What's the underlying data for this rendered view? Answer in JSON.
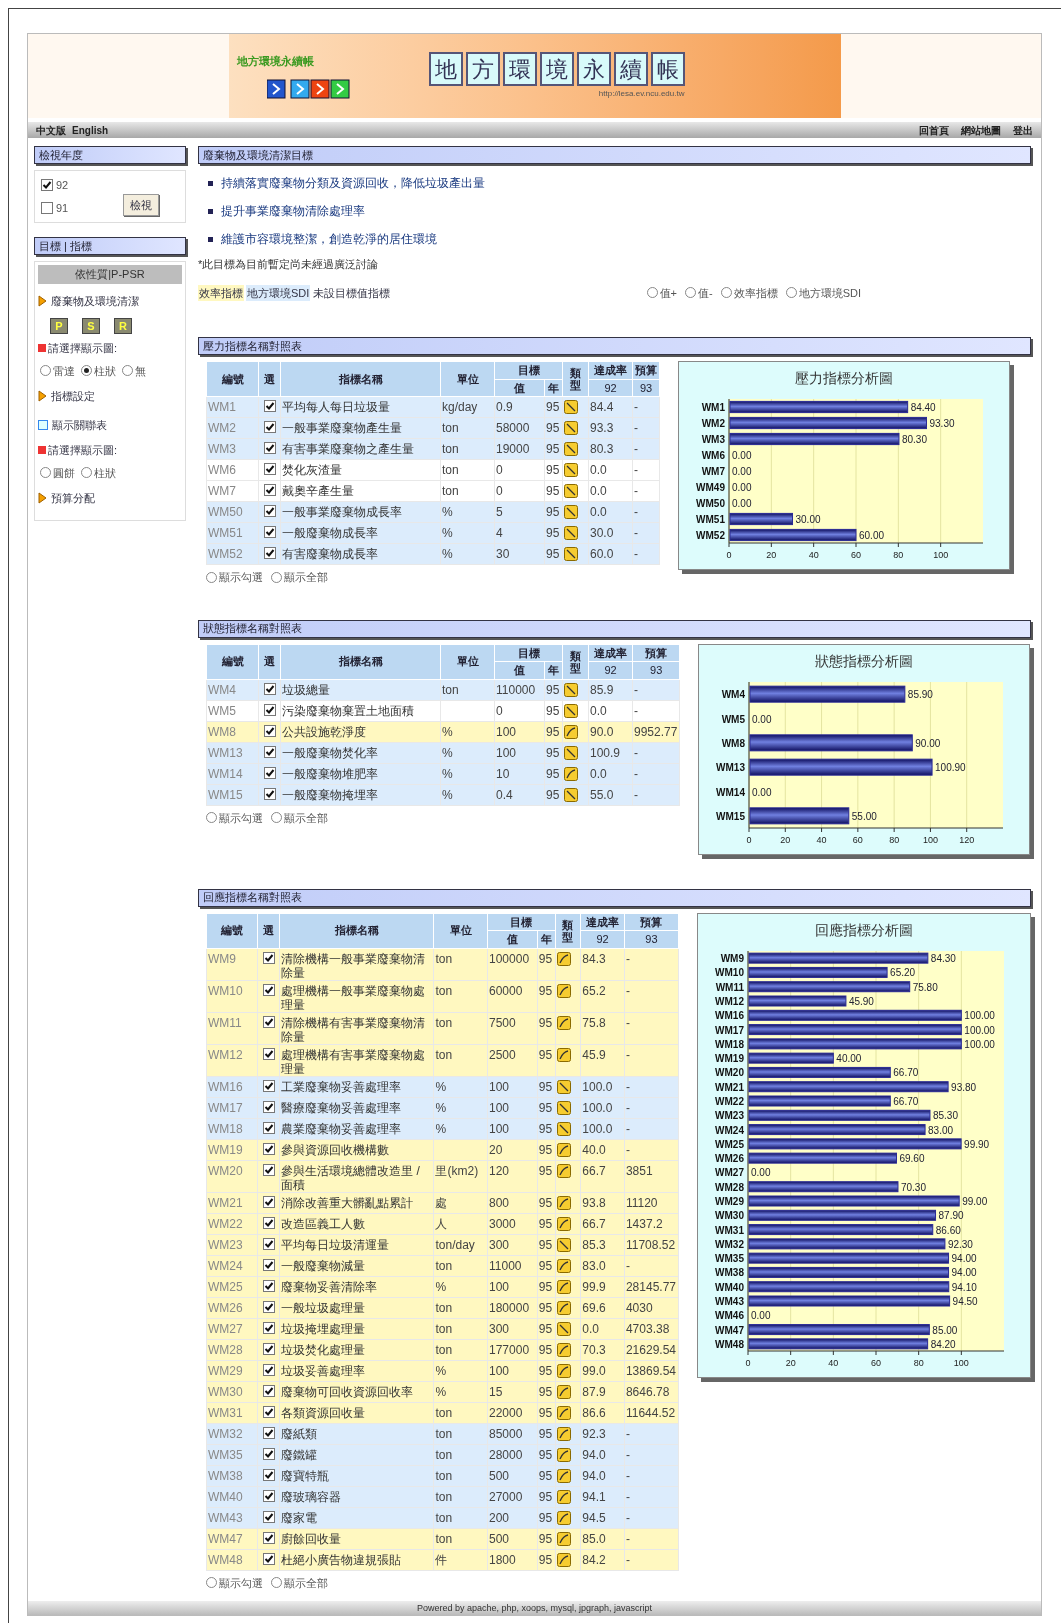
{
  "header": {
    "logo_text": "地方環境永續帳",
    "tiles": [
      "地",
      "方",
      "環",
      "境",
      "永",
      "續",
      "帳"
    ],
    "url": "http://lesa.ev.ncu.edu.tw"
  },
  "nav": {
    "left": [
      "中文版",
      "English"
    ],
    "right": [
      "回首頁",
      "網站地圖",
      "登出"
    ]
  },
  "year_panel": {
    "title": "檢視年度",
    "years": [
      {
        "label": "92",
        "checked": true
      },
      {
        "label": "91",
        "checked": false
      }
    ],
    "button": "檢視"
  },
  "goal_panel": {
    "title": "目標 | 指標",
    "subtitle": "依性質|P-PSR",
    "items": [
      {
        "kind": "arrow",
        "label": "廢棄物及環境清潔"
      },
      {
        "kind": "buttons",
        "labels": [
          "P",
          "S",
          "R"
        ]
      },
      {
        "kind": "prompt",
        "label": "請選擇顯示圖:"
      },
      {
        "kind": "radios",
        "options": [
          {
            "label": "雷達",
            "selected": false
          },
          {
            "label": "柱狀",
            "selected": true
          },
          {
            "label": "無",
            "selected": false
          }
        ]
      },
      {
        "kind": "arrow",
        "label": "指標設定"
      },
      {
        "kind": "table-link",
        "label": "顯示關聯表"
      },
      {
        "kind": "prompt",
        "label": "請選擇顯示圖:"
      },
      {
        "kind": "radios",
        "options": [
          {
            "label": "圓餅",
            "selected": false
          },
          {
            "label": "柱狀",
            "selected": false
          }
        ]
      },
      {
        "kind": "arrow",
        "label": "預算分配"
      }
    ]
  },
  "goals": {
    "title": "廢棄物及環境清潔目標",
    "items": [
      "持續落實廢棄物分類及資源回收，降低垃圾產出量",
      "提升事業廢棄物清除處理率",
      "維護市容環境整潔，創造乾淨的居住環境"
    ],
    "note": "*此目標為目前暫定尚未經過廣泛討論",
    "legend": [
      {
        "label": "效率指標",
        "color": "#fff8c0"
      },
      {
        "label": "地方環境SDI",
        "color": "#dcecfc"
      },
      {
        "label": "未設目標值指標"
      }
    ],
    "filters": [
      {
        "label": "值+",
        "selected": false
      },
      {
        "label": "值-",
        "selected": false
      },
      {
        "label": "效率指標",
        "selected": false
      },
      {
        "label": "地方環境SDI",
        "selected": false
      }
    ]
  },
  "sections": [
    {
      "title": "壓力指標名稱對照表",
      "headers": {
        "id": "編號",
        "select": "選",
        "name": "指標名稱",
        "unit": "單位",
        "target": "目標",
        "value": "值",
        "year": "年",
        "type": "類型",
        "rate": "達成率",
        "budget": "預算",
        "rate_year": "92",
        "budget_year": "93"
      },
      "rows": [
        {
          "id": "WM1",
          "checked": true,
          "name": "平均每人每日垃圾量",
          "unit": "kg/day",
          "target": "0.9",
          "year": "95",
          "kind": "down",
          "rate": "84.4",
          "budget": "-",
          "color": "#dcecfc"
        },
        {
          "id": "WM2",
          "checked": true,
          "name": "一般事業廢棄物產生量",
          "unit": "ton",
          "target": "58000",
          "year": "95",
          "kind": "down",
          "rate": "93.3",
          "budget": "-",
          "color": "#dcecfc"
        },
        {
          "id": "WM3",
          "checked": true,
          "name": "有害事業廢棄物之產生量",
          "unit": "ton",
          "target": "19000",
          "year": "95",
          "kind": "down",
          "rate": "80.3",
          "budget": "-",
          "color": "#dcecfc"
        },
        {
          "id": "WM6",
          "checked": true,
          "name": "焚化灰渣量",
          "unit": "ton",
          "target": "0",
          "year": "95",
          "kind": "down",
          "rate": "0.0",
          "budget": "-",
          "color": "#ffffff"
        },
        {
          "id": "WM7",
          "checked": true,
          "name": "戴奧辛產生量",
          "unit": "ton",
          "target": "0",
          "year": "95",
          "kind": "down",
          "rate": "0.0",
          "budget": "-",
          "color": "#ffffff"
        },
        {
          "id": "WM50",
          "checked": true,
          "name": "一般事業廢棄物成長率",
          "unit": "%",
          "target": "5",
          "year": "95",
          "kind": "down",
          "rate": "0.0",
          "budget": "-",
          "color": "#dcecfc"
        },
        {
          "id": "WM51",
          "checked": true,
          "name": "一般廢棄物成長率",
          "unit": "%",
          "target": "4",
          "year": "95",
          "kind": "down",
          "rate": "30.0",
          "budget": "-",
          "color": "#dcecfc"
        },
        {
          "id": "WM52",
          "checked": true,
          "name": "有害廢棄物成長率",
          "unit": "%",
          "target": "30",
          "year": "95",
          "kind": "down",
          "rate": "60.0",
          "budget": "-",
          "color": "#dcecfc"
        }
      ],
      "show": [
        {
          "label": "顯示勾選",
          "selected": false
        },
        {
          "label": "顯示全部",
          "selected": false
        }
      ],
      "chart_data": {
        "type": "bar",
        "orientation": "horizontal",
        "title": "壓力指標分析圖",
        "categories": [
          "WM1",
          "WM2",
          "WM3",
          "WM6",
          "WM7",
          "WM49",
          "WM50",
          "WM51",
          "WM52"
        ],
        "series": [
          {
            "color": "#2a2a96",
            "values": [
              84.4,
              93.3,
              80.3,
              0,
              0,
              0,
              0,
              30,
              60
            ]
          }
        ],
        "grid": true,
        "xlim": [
          0,
          120
        ],
        "xticks": [
          0,
          20,
          40,
          60,
          80,
          100
        ],
        "value_labels": [
          "84.40",
          "93.30",
          "80.30",
          "0.00",
          "0.00",
          "0.00",
          "0.00",
          "30.00",
          "60.00"
        ]
      }
    },
    {
      "title": "狀態指標名稱對照表",
      "headers": {
        "id": "編號",
        "select": "選",
        "name": "指標名稱",
        "unit": "單位",
        "target": "目標",
        "value": "值",
        "year": "年",
        "type": "類型",
        "rate": "達成率",
        "budget": "預算",
        "rate_year": "92",
        "budget_year": "93"
      },
      "rows": [
        {
          "id": "WM4",
          "checked": true,
          "name": "垃圾總量",
          "unit": "ton",
          "target": "110000",
          "year": "95",
          "kind": "down",
          "rate": "85.9",
          "budget": "-",
          "color": "#dcecfc"
        },
        {
          "id": "WM5",
          "checked": true,
          "name": "污染廢棄物棄置土地面積",
          "target": "0",
          "year": "95",
          "kind": "down",
          "rate": "0.0",
          "budget": "-",
          "color": "#ffffff"
        },
        {
          "id": "WM8",
          "checked": true,
          "name": "公共設施乾淨度",
          "unit": "%",
          "target": "100",
          "year": "95",
          "kind": "up",
          "rate": "90.0",
          "budget": "9952.77",
          "color": "#fff8c0"
        },
        {
          "id": "WM13",
          "checked": true,
          "name": "一般廢棄物焚化率",
          "unit": "%",
          "target": "100",
          "year": "95",
          "kind": "down",
          "rate": "100.9",
          "budget": "-",
          "color": "#dcecfc"
        },
        {
          "id": "WM14",
          "checked": true,
          "name": "一般廢棄物堆肥率",
          "unit": "%",
          "target": "10",
          "year": "95",
          "kind": "up",
          "rate": "0.0",
          "budget": "-",
          "color": "#dcecfc"
        },
        {
          "id": "WM15",
          "checked": true,
          "name": "一般廢棄物掩埋率",
          "unit": "%",
          "target": "0.4",
          "year": "95",
          "kind": "down",
          "rate": "55.0",
          "budget": "-",
          "color": "#dcecfc"
        }
      ],
      "show": [
        {
          "label": "顯示勾選",
          "selected": false
        },
        {
          "label": "顯示全部",
          "selected": false
        }
      ],
      "chart_data": {
        "type": "bar",
        "orientation": "horizontal",
        "title": "狀態指標分析圖",
        "categories": [
          "WM4",
          "WM5",
          "WM8",
          "WM13",
          "WM14",
          "WM15"
        ],
        "series": [
          {
            "color": "#2a2a96",
            "values": [
              85.9,
              0,
              90,
              100.9,
              0,
              55
            ]
          }
        ],
        "grid": true,
        "xlim": [
          0,
          140
        ],
        "xticks": [
          0,
          20,
          40,
          60,
          80,
          100,
          120
        ],
        "value_labels": [
          "85.90",
          "0.00",
          "90.00",
          "100.90",
          "0.00",
          "55.00"
        ]
      }
    },
    {
      "title": "回應指標名稱對照表",
      "headers": {
        "id": "編號",
        "select": "選",
        "name": "指標名稱",
        "unit": "單位",
        "target": "目標",
        "value": "值",
        "year": "年",
        "type": "類型",
        "rate": "達成率",
        "budget": "預算",
        "rate_year": "92",
        "budget_year": "93"
      },
      "rows": [
        {
          "id": "WM9",
          "checked": true,
          "name": "清除機構一般事業廢棄物清除量",
          "unit": "ton",
          "target": "100000",
          "year": "95",
          "kind": "up",
          "rate": "84.3",
          "budget": "-",
          "color": "#fff8c0"
        },
        {
          "id": "WM10",
          "checked": true,
          "name": "處理機構一般事業廢棄物處理量",
          "unit": "ton",
          "target": "60000",
          "year": "95",
          "kind": "up",
          "rate": "65.2",
          "budget": "-",
          "color": "#fff8c0"
        },
        {
          "id": "WM11",
          "checked": true,
          "name": "清除機構有害事業廢棄物清除量",
          "unit": "ton",
          "target": "7500",
          "year": "95",
          "kind": "up",
          "rate": "75.8",
          "budget": "-",
          "color": "#fff8c0"
        },
        {
          "id": "WM12",
          "checked": true,
          "name": "處理機構有害事業廢棄物處理量",
          "unit": "ton",
          "target": "2500",
          "year": "95",
          "kind": "up",
          "rate": "45.9",
          "budget": "-",
          "color": "#fff8c0"
        },
        {
          "id": "WM16",
          "checked": true,
          "name": "工業廢棄物妥善處理率",
          "unit": "%",
          "target": "100",
          "year": "95",
          "kind": "down",
          "rate": "100.0",
          "budget": "-",
          "color": "#dcecfc"
        },
        {
          "id": "WM17",
          "checked": true,
          "name": "醫療廢棄物妥善處理率",
          "unit": "%",
          "target": "100",
          "year": "95",
          "kind": "down",
          "rate": "100.0",
          "budget": "-",
          "color": "#dcecfc"
        },
        {
          "id": "WM18",
          "checked": true,
          "name": "農業廢棄物妥善處理率",
          "unit": "%",
          "target": "100",
          "year": "95",
          "kind": "down",
          "rate": "100.0",
          "budget": "-",
          "color": "#dcecfc"
        },
        {
          "id": "WM19",
          "checked": true,
          "name": "參與資源回收機構數",
          "target": "20",
          "year": "95",
          "kind": "up",
          "rate": "40.0",
          "budget": "-",
          "color": "#fff8c0"
        },
        {
          "id": "WM20",
          "checked": true,
          "name": "參與生活環境總體改造里 / 面積",
          "unit": "里(km2)",
          "target": "120",
          "year": "95",
          "kind": "up",
          "rate": "66.7",
          "budget": "3851",
          "color": "#fff8c0"
        },
        {
          "id": "WM21",
          "checked": true,
          "name": "消除改善重大髒亂點累計",
          "unit": "處",
          "target": "800",
          "year": "95",
          "kind": "up",
          "rate": "93.8",
          "budget": "11120",
          "color": "#fff8c0"
        },
        {
          "id": "WM22",
          "checked": true,
          "name": "改造區義工人數",
          "unit": "人",
          "target": "3000",
          "year": "95",
          "kind": "up",
          "rate": "66.7",
          "budget": "1437.2",
          "color": "#fff8c0"
        },
        {
          "id": "WM23",
          "checked": true,
          "name": "平均每日垃圾清運量",
          "unit": "ton/day",
          "target": "300",
          "year": "95",
          "kind": "down",
          "rate": "85.3",
          "budget": "11708.52",
          "color": "#fff8c0"
        },
        {
          "id": "WM24",
          "checked": true,
          "name": "一般廢棄物減量",
          "unit": "ton",
          "target": "11000",
          "year": "95",
          "kind": "up",
          "rate": "83.0",
          "budget": "-",
          "color": "#fff8c0"
        },
        {
          "id": "WM25",
          "checked": true,
          "name": "廢棄物妥善清除率",
          "unit": "%",
          "target": "100",
          "year": "95",
          "kind": "up",
          "rate": "99.9",
          "budget": "28145.77",
          "color": "#fff8c0"
        },
        {
          "id": "WM26",
          "checked": true,
          "name": "一般垃圾處理量",
          "unit": "ton",
          "target": "180000",
          "year": "95",
          "kind": "up",
          "rate": "69.6",
          "budget": "4030",
          "color": "#fff8c0"
        },
        {
          "id": "WM27",
          "checked": true,
          "name": "垃圾掩埋處理量",
          "unit": "ton",
          "target": "300",
          "year": "95",
          "kind": "down",
          "rate": "0.0",
          "budget": "4703.38",
          "color": "#fff8c0"
        },
        {
          "id": "WM28",
          "checked": true,
          "name": "垃圾焚化處理量",
          "unit": "ton",
          "target": "177000",
          "year": "95",
          "kind": "up",
          "rate": "70.3",
          "budget": "21629.54",
          "color": "#fff8c0"
        },
        {
          "id": "WM29",
          "checked": true,
          "name": "垃圾妥善處理率",
          "unit": "%",
          "target": "100",
          "year": "95",
          "kind": "up",
          "rate": "99.0",
          "budget": "13869.54",
          "color": "#fff8c0"
        },
        {
          "id": "WM30",
          "checked": true,
          "name": "廢棄物可回收資源回收率",
          "unit": "%",
          "target": "15",
          "year": "95",
          "kind": "up",
          "rate": "87.9",
          "budget": "8646.78",
          "color": "#fff8c0"
        },
        {
          "id": "WM31",
          "checked": true,
          "name": "各類資源回收量",
          "unit": "ton",
          "target": "22000",
          "year": "95",
          "kind": "up",
          "rate": "86.6",
          "budget": "11644.52",
          "color": "#fff8c0"
        },
        {
          "id": "WM32",
          "checked": true,
          "name": "廢紙類",
          "unit": "ton",
          "target": "85000",
          "year": "95",
          "kind": "up",
          "rate": "92.3",
          "budget": "-",
          "color": "#dcecfc"
        },
        {
          "id": "WM35",
          "checked": true,
          "name": "廢鐵罐",
          "unit": "ton",
          "target": "28000",
          "year": "95",
          "kind": "up",
          "rate": "94.0",
          "budget": "-",
          "color": "#dcecfc"
        },
        {
          "id": "WM38",
          "checked": true,
          "name": "廢寶特瓶",
          "unit": "ton",
          "target": "500",
          "year": "95",
          "kind": "up",
          "rate": "94.0",
          "budget": "-",
          "color": "#dcecfc"
        },
        {
          "id": "WM40",
          "checked": true,
          "name": "廢玻璃容器",
          "unit": "ton",
          "target": "27000",
          "year": "95",
          "kind": "up",
          "rate": "94.1",
          "budget": "-",
          "color": "#dcecfc"
        },
        {
          "id": "WM43",
          "checked": true,
          "name": "廢家電",
          "unit": "ton",
          "target": "200",
          "year": "95",
          "kind": "up",
          "rate": "94.5",
          "budget": "-",
          "color": "#dcecfc"
        },
        {
          "id": "WM47",
          "checked": true,
          "name": "廚餘回收量",
          "unit": "ton",
          "target": "500",
          "year": "95",
          "kind": "up",
          "rate": "85.0",
          "budget": "-",
          "color": "#fff8c0"
        },
        {
          "id": "WM48",
          "checked": true,
          "name": "杜絕小廣告物違規張貼",
          "unit": "件",
          "target": "1800",
          "year": "95",
          "kind": "up",
          "rate": "84.2",
          "budget": "-",
          "color": "#fff8c0"
        }
      ],
      "show": [
        {
          "label": "顯示勾選",
          "selected": false
        },
        {
          "label": "顯示全部",
          "selected": false
        }
      ],
      "chart_data": {
        "type": "bar",
        "orientation": "horizontal",
        "title": "回應指標分析圖",
        "categories": [
          "WM9",
          "WM10",
          "WM11",
          "WM12",
          "WM16",
          "WM17",
          "WM18",
          "WM19",
          "WM20",
          "WM21",
          "WM22",
          "WM23",
          "WM24",
          "WM25",
          "WM26",
          "WM27",
          "WM28",
          "WM29",
          "WM30",
          "WM31",
          "WM32",
          "WM35",
          "WM38",
          "WM40",
          "WM43",
          "WM46",
          "WM47",
          "WM48"
        ],
        "series": [
          {
            "color": "#2a2a96",
            "values": [
              84.3,
              65.2,
              75.8,
              45.9,
              100,
              100,
              100,
              40,
              66.7,
              93.8,
              66.7,
              85.3,
              83,
              99.9,
              69.6,
              0,
              70.3,
              99,
              87.9,
              86.6,
              92.3,
              94,
              94,
              94.1,
              94.5,
              0,
              85,
              84.2
            ]
          }
        ],
        "grid": true,
        "xlim": [
          0,
          120
        ],
        "xticks": [
          0,
          20,
          40,
          60,
          80,
          100
        ],
        "value_labels": [
          "84.30",
          "65.20",
          "75.80",
          "45.90",
          "100.00",
          "100.00",
          "100.00",
          "40.00",
          "66.70",
          "93.80",
          "66.70",
          "85.30",
          "83.00",
          "99.90",
          "69.60",
          "0.00",
          "70.30",
          "99.00",
          "87.90",
          "86.60",
          "92.30",
          "94.00",
          "94.00",
          "94.10",
          "94.50",
          "0.00",
          "85.00",
          "84.20"
        ]
      }
    }
  ],
  "footer": "Powered by apache, php, xoops, mysql, jpgraph, javascript"
}
